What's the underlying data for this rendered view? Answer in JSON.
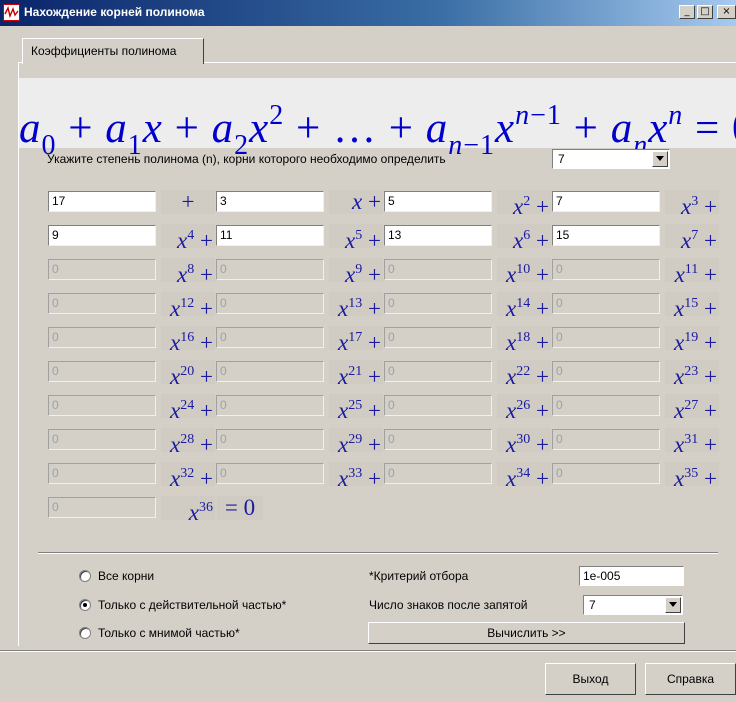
{
  "window": {
    "title": "Нахождение корней полинома",
    "minimize_label": "_",
    "maximize_label": "□",
    "close_label": "×"
  },
  "tab": {
    "label": "Коэффициенты полинома"
  },
  "degree": {
    "prompt": "Укажите степень полинома (n), корни которого необходимо определить",
    "value": "7"
  },
  "coefficients": [
    {
      "value": "17",
      "enabled": true,
      "term": "+"
    },
    {
      "value": "3",
      "enabled": true,
      "term": "x +"
    },
    {
      "value": "5",
      "enabled": true,
      "term": "x2 +"
    },
    {
      "value": "7",
      "enabled": true,
      "term": "x3 +"
    },
    {
      "value": "9",
      "enabled": true,
      "term": "x4 +"
    },
    {
      "value": "11",
      "enabled": true,
      "term": "x5 +"
    },
    {
      "value": "13",
      "enabled": true,
      "term": "x6 +"
    },
    {
      "value": "15",
      "enabled": true,
      "term": "x7 +"
    },
    {
      "value": "0",
      "enabled": false,
      "term": "x8 +"
    },
    {
      "value": "0",
      "enabled": false,
      "term": "x9 +"
    },
    {
      "value": "0",
      "enabled": false,
      "term": "x10+"
    },
    {
      "value": "0",
      "enabled": false,
      "term": "x11+"
    },
    {
      "value": "0",
      "enabled": false,
      "term": "x12+"
    },
    {
      "value": "0",
      "enabled": false,
      "term": "x13+"
    },
    {
      "value": "0",
      "enabled": false,
      "term": "x14+"
    },
    {
      "value": "0",
      "enabled": false,
      "term": "x15+"
    },
    {
      "value": "0",
      "enabled": false,
      "term": "x16+"
    },
    {
      "value": "0",
      "enabled": false,
      "term": "x17+"
    },
    {
      "value": "0",
      "enabled": false,
      "term": "x18+"
    },
    {
      "value": "0",
      "enabled": false,
      "term": "x19+"
    },
    {
      "value": "0",
      "enabled": false,
      "term": "x20+"
    },
    {
      "value": "0",
      "enabled": false,
      "term": "x21+"
    },
    {
      "value": "0",
      "enabled": false,
      "term": "x22+"
    },
    {
      "value": "0",
      "enabled": false,
      "term": "x23+"
    },
    {
      "value": "0",
      "enabled": false,
      "term": "x24+"
    },
    {
      "value": "0",
      "enabled": false,
      "term": "x25+"
    },
    {
      "value": "0",
      "enabled": false,
      "term": "x26+"
    },
    {
      "value": "0",
      "enabled": false,
      "term": "x27+"
    },
    {
      "value": "0",
      "enabled": false,
      "term": "x28+"
    },
    {
      "value": "0",
      "enabled": false,
      "term": "x29+"
    },
    {
      "value": "0",
      "enabled": false,
      "term": "x30+"
    },
    {
      "value": "0",
      "enabled": false,
      "term": "x31+"
    },
    {
      "value": "0",
      "enabled": false,
      "term": "x32+"
    },
    {
      "value": "0",
      "enabled": false,
      "term": "x33+"
    },
    {
      "value": "0",
      "enabled": false,
      "term": "x34+"
    },
    {
      "value": "0",
      "enabled": false,
      "term": "x35+"
    },
    {
      "value": "0",
      "enabled": false,
      "term": "x36"
    }
  ],
  "equals_label": "= 0",
  "options": {
    "all_roots": "Все корни",
    "real_only": "Только с действительной частью*",
    "imag_only": "Только с мнимой частью*",
    "selected": "real_only"
  },
  "criterion": {
    "label": "*Критерий отбора",
    "value": "1e-005"
  },
  "decimals": {
    "label": "Число знаков после запятой",
    "value": "7"
  },
  "buttons": {
    "compute": "Вычислить >>",
    "exit": "Выход",
    "help": "Справка"
  }
}
